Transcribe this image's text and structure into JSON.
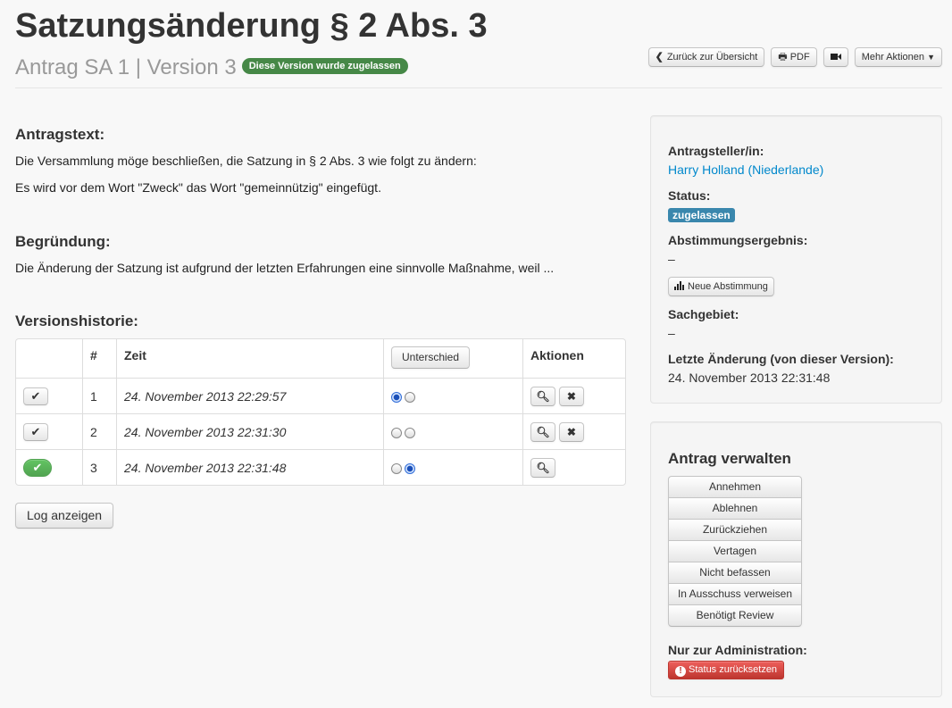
{
  "header": {
    "title": "Satzungsänderung § 2 Abs. 3",
    "subtitle": "Antrag SA 1 | Version 3",
    "version_badge": "Diese Version wurde zugelassen",
    "actions": {
      "back": "Zurück zur Übersicht",
      "pdf": "PDF",
      "more": "Mehr Aktionen"
    }
  },
  "main": {
    "motion_heading": "Antragstext:",
    "motion_text_1": "Die Versammlung möge beschließen, die Satzung in § 2 Abs. 3 wie folgt zu ändern:",
    "motion_text_2": "Es wird vor dem Wort \"Zweck\" das Wort \"gemeinnützig\" eingefügt.",
    "reason_heading": "Begründung:",
    "reason_text": "Die Änderung der Satzung ist aufgrund der letzten Erfahrungen eine sinnvolle Maßnahme, weil ...",
    "history_heading": "Versionshistorie:",
    "history_table": {
      "columns": [
        "",
        "#",
        "Zeit",
        "Unterschied",
        "Aktionen"
      ],
      "diff_button": "Unterschied",
      "rows": [
        {
          "num": "1",
          "time": "24. November 2013 22:29:57"
        },
        {
          "num": "2",
          "time": "24. November 2013 22:31:30"
        },
        {
          "num": "3",
          "time": "24. November 2013 22:31:48"
        }
      ]
    },
    "log_button": "Log anzeigen"
  },
  "sidebar": {
    "submitter_label": "Antragsteller/in:",
    "submitter_value": "Harry Holland (Niederlande)",
    "status_label": "Status:",
    "status_value": "zugelassen",
    "vote_label": "Abstimmungsergebnis:",
    "vote_value": "–",
    "new_vote_button": "Neue Abstimmung",
    "category_label": "Sachgebiet:",
    "category_value": "–",
    "last_change_label": "Letzte Änderung (von dieser Version):",
    "last_change_value": "24. November 2013 22:31:48"
  },
  "manage": {
    "heading": "Antrag verwalten",
    "buttons": [
      "Annehmen",
      "Ablehnen",
      "Zurückziehen",
      "Vertagen",
      "Nicht befassen",
      "In Ausschuss verweisen",
      "Benötigt Review"
    ],
    "admin_label": "Nur zur Administration:",
    "reset_button": "Status zurücksetzen"
  },
  "colors": {
    "success": "#468847",
    "info": "#3a87ad",
    "danger": "#bd362f",
    "link": "#0088cc"
  }
}
